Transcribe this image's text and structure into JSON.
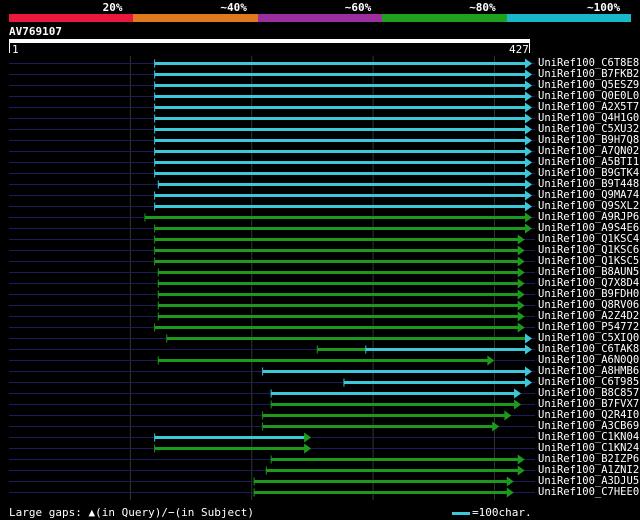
{
  "legend": [
    {
      "label": "20%",
      "color": "#e8193c"
    },
    {
      "label": "~40%",
      "color": "#e07820"
    },
    {
      "label": "~60%",
      "color": "#9b2fa0"
    },
    {
      "label": "~80%",
      "color": "#1fa01f"
    },
    {
      "label": "~100%",
      "color": "#18b8c8"
    }
  ],
  "query": {
    "name": "AV769107",
    "start": "1",
    "end": "427",
    "length": 427
  },
  "colors": {
    "cyan": "#3cc8d8",
    "green": "#1d9a1d",
    "navy": "#1c1c5a",
    "grid": "#333333"
  },
  "hits": [
    {
      "name": "UniRef100_C6T8E8",
      "segs": [
        [
          121,
          427,
          "c"
        ]
      ],
      "arrow": "c"
    },
    {
      "name": "UniRef100_B7FKB2",
      "segs": [
        [
          121,
          427,
          "c"
        ]
      ],
      "arrow": "c"
    },
    {
      "name": "UniRef100_Q5ESZ9",
      "segs": [
        [
          121,
          427,
          "c"
        ]
      ],
      "arrow": "c"
    },
    {
      "name": "UniRef100_Q0E0L0",
      "segs": [
        [
          121,
          427,
          "c"
        ]
      ],
      "arrow": "c"
    },
    {
      "name": "UniRef100_A2X5T7",
      "segs": [
        [
          121,
          427,
          "c"
        ]
      ],
      "arrow": "c"
    },
    {
      "name": "UniRef100_Q4H1G0",
      "segs": [
        [
          121,
          427,
          "c"
        ]
      ],
      "arrow": "c"
    },
    {
      "name": "UniRef100_C5XU32",
      "segs": [
        [
          121,
          427,
          "c"
        ]
      ],
      "arrow": "c"
    },
    {
      "name": "UniRef100_B9H7Q8",
      "segs": [
        [
          121,
          427,
          "c"
        ]
      ],
      "arrow": "c"
    },
    {
      "name": "UniRef100_A7QN02",
      "segs": [
        [
          121,
          427,
          "c"
        ]
      ],
      "arrow": "c"
    },
    {
      "name": "UniRef100_A5BTI1",
      "segs": [
        [
          121,
          427,
          "c"
        ]
      ],
      "arrow": "c"
    },
    {
      "name": "UniRef100_B9GTK4",
      "segs": [
        [
          121,
          427,
          "c"
        ]
      ],
      "arrow": "c"
    },
    {
      "name": "UniRef100_B9T448",
      "segs": [
        [
          124,
          427,
          "c"
        ]
      ],
      "arrow": "c"
    },
    {
      "name": "UniRef100_Q9MA74",
      "segs": [
        [
          121,
          427,
          "c"
        ]
      ],
      "arrow": "c"
    },
    {
      "name": "UniRef100_Q9SXL2",
      "segs": [
        [
          121,
          427,
          "c"
        ]
      ],
      "arrow": "c"
    },
    {
      "name": "UniRef100_A9RJP6",
      "segs": [
        [
          113,
          427,
          "g"
        ]
      ],
      "arrow": "g"
    },
    {
      "name": "UniRef100_A9S4E6",
      "segs": [
        [
          121,
          427,
          "g"
        ]
      ],
      "arrow": "g"
    },
    {
      "name": "UniRef100_Q1KSC4",
      "segs": [
        [
          121,
          421,
          "g"
        ]
      ],
      "arrow": "g"
    },
    {
      "name": "UniRef100_Q1KSC6",
      "segs": [
        [
          121,
          421,
          "g"
        ]
      ],
      "arrow": "g"
    },
    {
      "name": "UniRef100_Q1KSC5",
      "segs": [
        [
          121,
          421,
          "g"
        ]
      ],
      "arrow": "g"
    },
    {
      "name": "UniRef100_B8AUN5",
      "segs": [
        [
          124,
          421,
          "g"
        ]
      ],
      "arrow": "g"
    },
    {
      "name": "UniRef100_Q7X8D4",
      "segs": [
        [
          124,
          421,
          "g"
        ]
      ],
      "arrow": "g"
    },
    {
      "name": "UniRef100_B9FDH0",
      "segs": [
        [
          124,
          421,
          "g"
        ]
      ],
      "arrow": "g"
    },
    {
      "name": "UniRef100_Q8RV06",
      "segs": [
        [
          124,
          421,
          "g"
        ]
      ],
      "arrow": "g"
    },
    {
      "name": "UniRef100_A2Z4D2",
      "segs": [
        [
          124,
          421,
          "g"
        ]
      ],
      "arrow": "g"
    },
    {
      "name": "UniRef100_P54772",
      "segs": [
        [
          121,
          421,
          "g"
        ]
      ],
      "arrow": "g"
    },
    {
      "name": "UniRef100_C5XIQ0",
      "segs": [
        [
          131,
          427,
          "g"
        ]
      ],
      "arrow": "c"
    },
    {
      "name": "UniRef100_C6TAK8",
      "segs": [
        [
          255,
          295,
          "g"
        ],
        [
          295,
          427,
          "c"
        ]
      ],
      "arrow": "c"
    },
    {
      "name": "UniRef100_A6N0Q0",
      "segs": [
        [
          124,
          396,
          "g"
        ]
      ],
      "arrow": "g"
    },
    {
      "name": "UniRef100_A8HMB6",
      "segs": [
        [
          210,
          427,
          "c"
        ]
      ],
      "arrow": "c"
    },
    {
      "name": "UniRef100_C6T985",
      "segs": [
        [
          277,
          427,
          "c"
        ]
      ],
      "arrow": "c"
    },
    {
      "name": "UniRef100_B8C857",
      "segs": [
        [
          217,
          418,
          "c"
        ]
      ],
      "arrow": "c"
    },
    {
      "name": "UniRef100_B7FVX7",
      "segs": [
        [
          217,
          418,
          "g"
        ]
      ],
      "arrow": "g"
    },
    {
      "name": "UniRef100_Q2R4I0",
      "segs": [
        [
          210,
          410,
          "g"
        ]
      ],
      "arrow": "g"
    },
    {
      "name": "UniRef100_A3CB69",
      "segs": [
        [
          210,
          400,
          "g"
        ]
      ],
      "arrow": "g"
    },
    {
      "name": "UniRef100_C1KN04",
      "segs": [
        [
          121,
          245,
          "c"
        ]
      ],
      "arrow": "g"
    },
    {
      "name": "UniRef100_C1KN24",
      "segs": [
        [
          121,
          245,
          "g"
        ]
      ],
      "arrow": "g"
    },
    {
      "name": "UniRef100_B2IZP6",
      "segs": [
        [
          217,
          421,
          "g"
        ]
      ],
      "arrow": "g"
    },
    {
      "name": "UniRef100_A1ZNI2",
      "segs": [
        [
          213,
          421,
          "g"
        ]
      ],
      "arrow": "g"
    },
    {
      "name": "UniRef100_A3DJU5",
      "segs": [
        [
          203,
          412,
          "g"
        ]
      ],
      "arrow": "g"
    },
    {
      "name": "UniRef100_C7HEE0",
      "segs": [
        [
          203,
          412,
          "g"
        ]
      ],
      "arrow": "g"
    }
  ],
  "footer": {
    "gaps": "Large gaps: ▲(in Query)/−(in Subject)",
    "scale": "=100char."
  }
}
